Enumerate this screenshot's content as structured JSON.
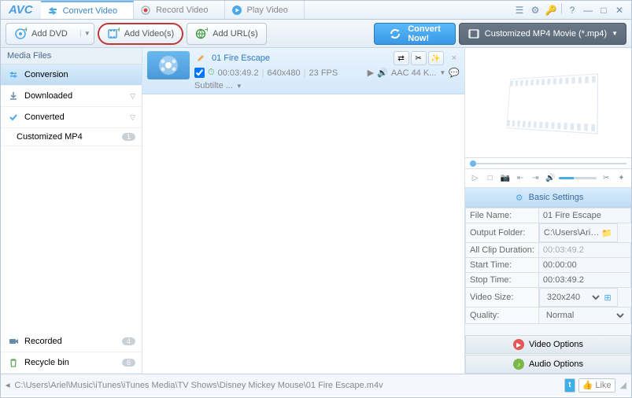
{
  "app": {
    "logo": "AVC"
  },
  "tabs": [
    {
      "label": "Convert Video",
      "active": true
    },
    {
      "label": "Record Video",
      "active": false
    },
    {
      "label": "Play Video",
      "active": false
    }
  ],
  "toolbar": {
    "add_dvd": "Add DVD",
    "add_videos": "Add Video(s)",
    "add_urls": "Add URL(s)",
    "convert": "Convert Now!",
    "profile": "Customized MP4 Movie (*.mp4)"
  },
  "sidebar": {
    "header": "Media Files",
    "conversion": "Conversion",
    "downloaded": "Downloaded",
    "converted": "Converted",
    "converted_child": "Customized MP4",
    "converted_badge": "1",
    "recorded": "Recorded",
    "recorded_badge": "4",
    "recycle": "Recycle bin",
    "recycle_badge": "6"
  },
  "file": {
    "title": "01 Fire Escape",
    "duration": "00:03:49.2",
    "resolution": "640x480",
    "fps": "23 FPS",
    "audio": "AAC 44 K...",
    "subtitle": "Subtilte ..."
  },
  "settings": {
    "header": "Basic Settings",
    "file_name_label": "File Name:",
    "file_name": "01 Fire Escape",
    "output_folder_label": "Output Folder:",
    "output_folder": "C:\\Users\\Ariel\\Videos\\A...",
    "all_clip_label": "All Clip Duration:",
    "all_clip": "00:03:49.2",
    "start_label": "Start Time:",
    "start": "00:00:00",
    "stop_label": "Stop Time:",
    "stop": "00:03:49.2",
    "vsize_label": "Video Size:",
    "vsize": "320x240",
    "quality_label": "Quality:",
    "quality": "Normal",
    "video_options": "Video Options",
    "audio_options": "Audio Options"
  },
  "status": {
    "path": "C:\\Users\\Ariel\\Music\\iTunes\\iTunes Media\\TV Shows\\Disney Mickey Mouse\\01 Fire Escape.m4v",
    "like": "Like"
  }
}
